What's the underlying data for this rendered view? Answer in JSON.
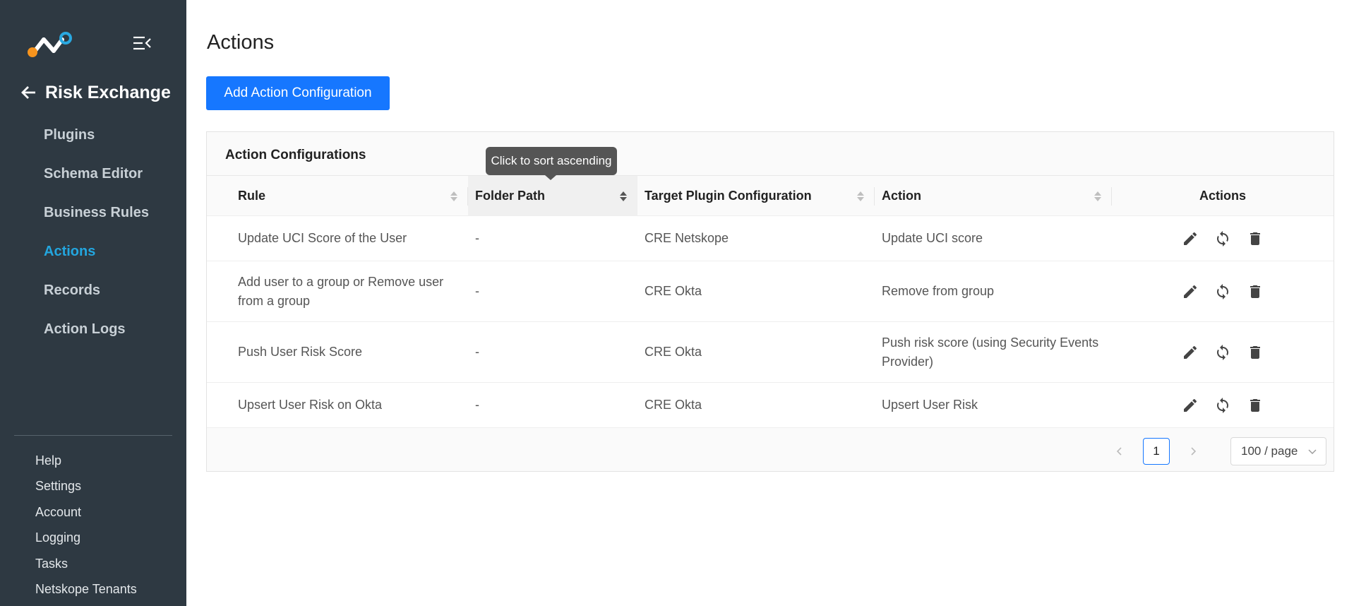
{
  "sidebar": {
    "module_title": "Risk Exchange",
    "items": [
      {
        "label": "Plugins"
      },
      {
        "label": "Schema Editor"
      },
      {
        "label": "Business Rules"
      },
      {
        "label": "Actions",
        "active": true
      },
      {
        "label": "Records"
      },
      {
        "label": "Action Logs"
      }
    ],
    "bottom_items": [
      {
        "label": "Help"
      },
      {
        "label": "Settings"
      },
      {
        "label": "Account"
      },
      {
        "label": "Logging"
      },
      {
        "label": "Tasks"
      },
      {
        "label": "Netskope Tenants"
      }
    ]
  },
  "page": {
    "title": "Actions",
    "add_button_label": "Add Action Configuration"
  },
  "card": {
    "title": "Action Configurations",
    "columns": [
      "Rule",
      "Folder Path",
      "Target Plugin Configuration",
      "Action",
      "Actions"
    ],
    "rows": [
      {
        "rule": "Update UCI Score of the User",
        "folder": "-",
        "target": "CRE Netskope",
        "action": "Update UCI score"
      },
      {
        "rule": "Add user to a group or Remove user from a group",
        "folder": "-",
        "target": "CRE Okta",
        "action": "Remove from group"
      },
      {
        "rule": "Push User Risk Score",
        "folder": "-",
        "target": "CRE Okta",
        "action": "Push risk score (using Security Events Provider)"
      },
      {
        "rule": "Upsert User Risk on Okta",
        "folder": "-",
        "target": "CRE Okta",
        "action": "Upsert User Risk"
      }
    ],
    "row_icons": [
      "pencil-icon",
      "sync-icon",
      "trash-icon"
    ]
  },
  "pagination": {
    "prev_icon": "chevron-left-icon",
    "current_page": "1",
    "next_icon": "chevron-right-icon",
    "page_size": "100 / page"
  },
  "tooltip": {
    "text": "Click to sort ascending"
  },
  "colors": {
    "sidebar_bg": "#2e3942",
    "active_nav": "#23a6df",
    "primary": "#1677ff",
    "logo_orange": "#f7941d",
    "logo_teal": "#29a8e0"
  }
}
